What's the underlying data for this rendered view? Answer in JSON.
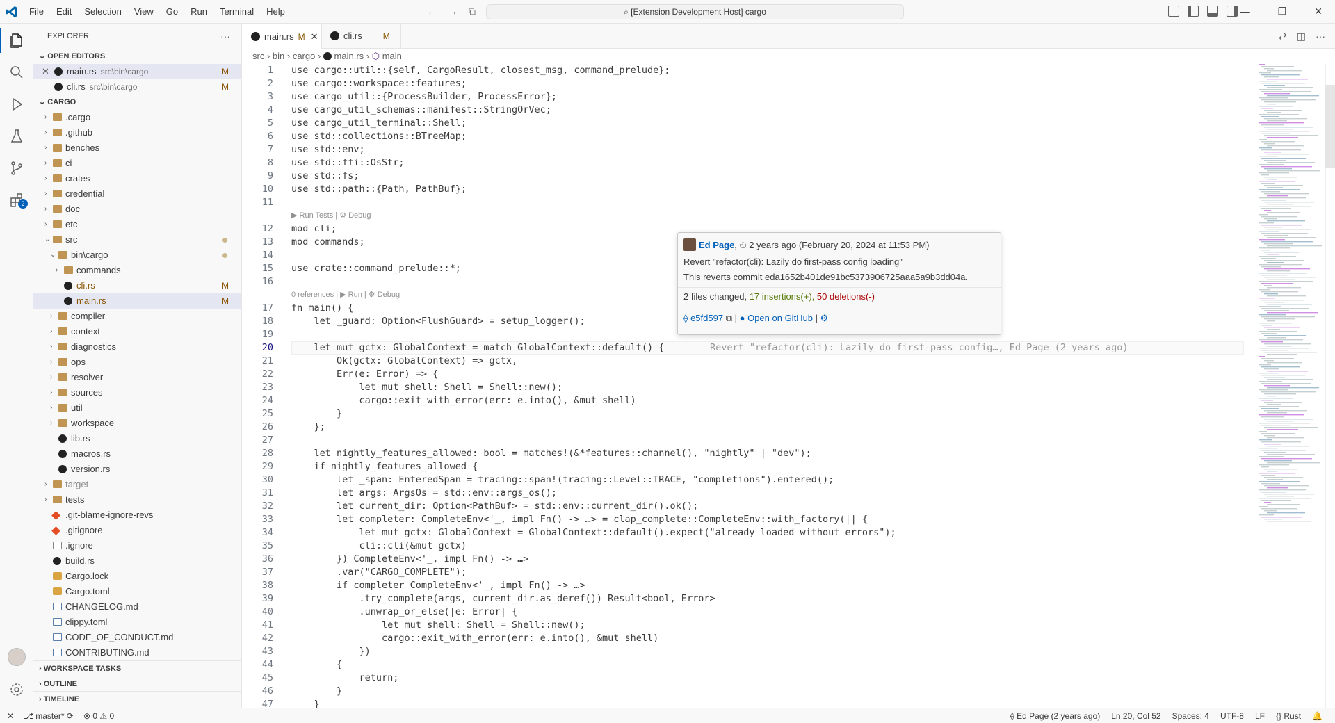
{
  "titlebar": {
    "menus": [
      "File",
      "Edit",
      "Selection",
      "View",
      "Go",
      "Run",
      "Terminal",
      "Help"
    ],
    "search": "[Extension Development Host] cargo"
  },
  "activity": {
    "source_control_badge": "2"
  },
  "explorer": {
    "title": "EXPLORER",
    "open_editors_header": "OPEN EDITORS",
    "open_editors": [
      {
        "name": "main.rs",
        "path": "src\\bin\\cargo",
        "status": "M"
      },
      {
        "name": "cli.rs",
        "path": "src\\bin\\cargo",
        "status": "M"
      }
    ],
    "workspace_header": "CARGO",
    "tree": [
      {
        "name": ".cargo",
        "type": "folder"
      },
      {
        "name": ".github",
        "type": "folder"
      },
      {
        "name": "benches",
        "type": "folder"
      },
      {
        "name": "ci",
        "type": "folder"
      },
      {
        "name": "crates",
        "type": "folder"
      },
      {
        "name": "credential",
        "type": "folder"
      },
      {
        "name": "doc",
        "type": "folder"
      },
      {
        "name": "etc",
        "type": "folder"
      },
      {
        "name": "src",
        "type": "folder-open"
      },
      {
        "name": "bin\\cargo",
        "type": "folder-open"
      },
      {
        "name": "commands",
        "type": "folder"
      },
      {
        "name": "cli.rs",
        "type": "rust",
        "status": "M"
      },
      {
        "name": "main.rs",
        "type": "rust",
        "status": "M"
      },
      {
        "name": "compiler",
        "type": "folder"
      },
      {
        "name": "context",
        "type": "folder"
      },
      {
        "name": "diagnostics",
        "type": "folder"
      },
      {
        "name": "ops",
        "type": "folder"
      },
      {
        "name": "resolver",
        "type": "folder"
      },
      {
        "name": "sources",
        "type": "folder"
      },
      {
        "name": "util",
        "type": "folder"
      },
      {
        "name": "workspace",
        "type": "folder"
      },
      {
        "name": "lib.rs",
        "type": "rust"
      },
      {
        "name": "macros.rs",
        "type": "rust"
      },
      {
        "name": "version.rs",
        "type": "rust"
      },
      {
        "name": "target",
        "type": "folder"
      },
      {
        "name": "tests",
        "type": "folder"
      },
      {
        "name": ".git-blame-ignore-revs",
        "type": "git"
      },
      {
        "name": ".gitignore",
        "type": "git"
      },
      {
        "name": ".ignore",
        "type": "blank"
      },
      {
        "name": "build.rs",
        "type": "rust"
      },
      {
        "name": "Cargo.lock",
        "type": "lock"
      },
      {
        "name": "Cargo.toml",
        "type": "lock"
      },
      {
        "name": "CHANGELOG.md",
        "type": "md"
      },
      {
        "name": "clippy.toml",
        "type": "toml"
      },
      {
        "name": "CODE_OF_CONDUCT.md",
        "type": "md"
      },
      {
        "name": "CONTRIBUTING.md",
        "type": "md"
      }
    ],
    "bottom_sections": [
      "WORKSPACE TASKS",
      "OUTLINE",
      "TIMELINE"
    ]
  },
  "tabs": [
    {
      "name": "main.rs",
      "status": "M"
    },
    {
      "name": "cli.rs",
      "status": "M"
    }
  ],
  "breadcrumb": {
    "seg1": "src",
    "seg2": "bin",
    "seg3": "cargo",
    "seg4": "main.rs",
    "seg5": "main"
  },
  "codelens": {
    "tests": "▶ Run Tests | ⚙ Debug",
    "main": "0 references | ▶ Run | ⚙ Debug"
  },
  "code_lines": [
    {
      "n": "1",
      "text": "use cargo::util::{self, CargoResult, closest_msg, command_prelude};"
    },
    {
      "n": "2",
      "text": "use cargo::workspace::features;"
    },
    {
      "n": "3",
      "text": "use cargo_util::{ProcessBuilder, ProcessError};"
    },
    {
      "n": "4",
      "text": "use cargo_util_schemas::manifest::StringOrVec;"
    },
    {
      "n": "5",
      "text": "use cargo_util_terminal::Shell;"
    },
    {
      "n": "6",
      "text": "use std::collections::BTreeMap;"
    },
    {
      "n": "7",
      "text": "use std::env;"
    },
    {
      "n": "8",
      "text": "use std::ffi::OsStr;"
    },
    {
      "n": "9",
      "text": "use std::fs;"
    },
    {
      "n": "10",
      "text": "use std::path::{Path, PathBuf};"
    },
    {
      "n": "11",
      "text": ""
    },
    {
      "n": "12",
      "text": "mod cli;"
    },
    {
      "n": "13",
      "text": "mod commands;"
    },
    {
      "n": "14",
      "text": ""
    },
    {
      "n": "15",
      "text": "use crate::command_prelude::*;"
    },
    {
      "n": "16",
      "text": ""
    },
    {
      "n": "17",
      "text": "fn main() {"
    },
    {
      "n": "18",
      "text": "    let _guard: Option<FlushGuard> = setup_logger();"
    },
    {
      "n": "19",
      "text": ""
    },
    {
      "n": "20",
      "text": "    let mut gctx: GlobalContext = match GlobalContext::default() {"
    },
    {
      "n": "21",
      "text": "        Ok(gctx: GlobalContext) => gctx,"
    },
    {
      "n": "22",
      "text": "        Err(e: Error) => {"
    },
    {
      "n": "23",
      "text": "            let mut shell: Shell = Shell::new();"
    },
    {
      "n": "24",
      "text": "            cargo::exit_with_error(err: e.into(), &mut shell)"
    },
    {
      "n": "25",
      "text": "        }"
    },
    {
      "n": "26",
      "text": "    };"
    },
    {
      "n": "27",
      "text": ""
    },
    {
      "n": "28",
      "text": "    let nightly_features_allowed: bool = matches!(&*features::channel(), \"nightly\" | \"dev\");"
    },
    {
      "n": "29",
      "text": "    if nightly_features_allowed {"
    },
    {
      "n": "30",
      "text": "        let _span: EnteredSpan = tracing::span!(tracing::Level::TRACE, \"completions\").entered();"
    },
    {
      "n": "31",
      "text": "        let args: ArgsOs = std::env::args_os();"
    },
    {
      "n": "32",
      "text": "        let current_dir: Option<PathBuf> = std::env::current_dir().ok();"
    },
    {
      "n": "33",
      "text": "        let completer: CompleteEnv<'_, impl Fn() -> …> = clap_complete::CompleteEnv::with_factory(|| {"
    },
    {
      "n": "34",
      "text": "            let mut gctx: GlobalContext = GlobalContext::default().expect(\"already loaded without errors\");"
    },
    {
      "n": "35",
      "text": "            cli::cli(&mut gctx)"
    },
    {
      "n": "36",
      "text": "        }) CompleteEnv<'_, impl Fn() -> …>"
    },
    {
      "n": "37",
      "text": "        .var(\"CARGO_COMPLETE\");"
    },
    {
      "n": "38",
      "text": "        if completer CompleteEnv<'_, impl Fn() -> …>"
    },
    {
      "n": "39",
      "text": "            .try_complete(args, current_dir.as_deref()) Result<bool, Error>"
    },
    {
      "n": "40",
      "text": "            .unwrap_or_else(|e: Error| {"
    },
    {
      "n": "41",
      "text": "                let mut shell: Shell = Shell::new();"
    },
    {
      "n": "42",
      "text": "                cargo::exit_with_error(err: e.into(), &mut shell)"
    },
    {
      "n": "43",
      "text": "            })"
    },
    {
      "n": "44",
      "text": "        {"
    },
    {
      "n": "45",
      "text": "            return;"
    },
    {
      "n": "46",
      "text": "        }"
    },
    {
      "n": "47",
      "text": "    }"
    }
  ],
  "inline_blame": "Revert \"refactor(cli): Lazily do first-pass config…, Ed Page (2 years ago)",
  "hover": {
    "author": "Ed Page",
    "date": "2 years ago (February 20, 2024 at 11:53 PM)",
    "subject": "Revert \"refactor(cli): Lazily do first-pass config loading\"",
    "body": "This reverts commit eda1652b401de91bc5373906725aaa5a9b3dd04a.",
    "files_changed": "2 files changed,",
    "insertions": "17 insertions(+),",
    "deletions": "50 deletions(-)",
    "hash": "e5fd597",
    "open_link": "Open on GitHub"
  },
  "statusbar": {
    "branch": "master*",
    "problems": "⊗ 0 ⚠ 0",
    "blame": "Ed Page (2 years ago)",
    "position": "Ln 20, Col 52",
    "spaces": "Spaces: 4",
    "encoding": "UTF-8",
    "eol": "LF",
    "language": "Rust"
  },
  "colors": {
    "accent": "#005fb8",
    "modified": "#895503"
  }
}
